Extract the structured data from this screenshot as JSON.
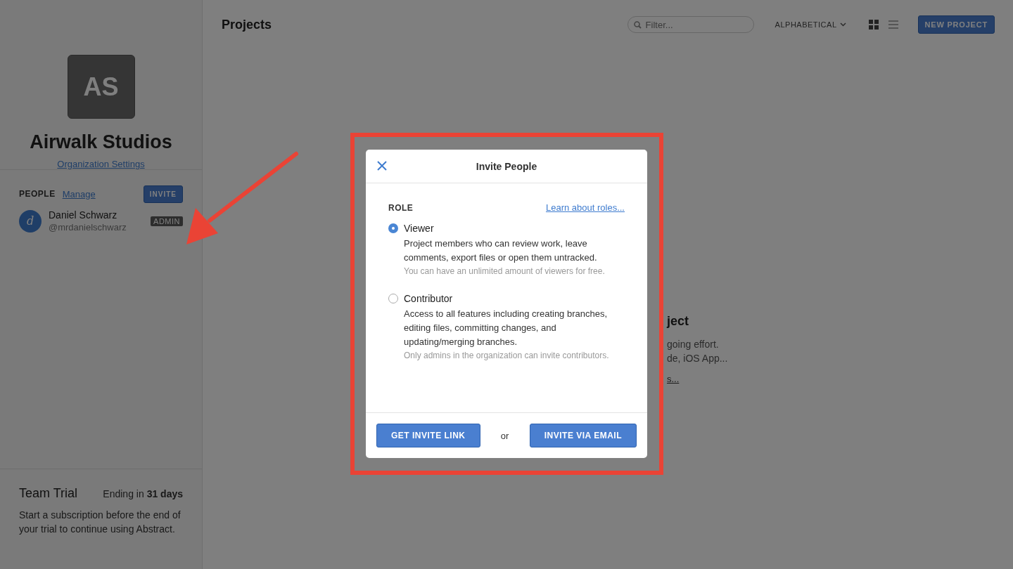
{
  "sidebar": {
    "org": {
      "initials": "AS",
      "name": "Airwalk Studios",
      "settings_link": "Organization Settings"
    },
    "people": {
      "heading": "PEOPLE",
      "manage_link": "Manage",
      "invite_button": "INVITE",
      "members": [
        {
          "avatar": "d",
          "name": "Daniel Schwarz",
          "handle": "@mrdanielschwarz",
          "role": "ADMIN"
        }
      ]
    },
    "trial": {
      "title": "Team Trial",
      "ending": "Ending in **31 days**",
      "body": "Start a subscription before the end of your trial to continue using Abstract."
    }
  },
  "header": {
    "title": "Projects",
    "filter": {
      "placeholder": "Filter..."
    },
    "sort": "ALPHABETICAL",
    "views": [
      {
        "kind": "grid",
        "selected": true
      },
      {
        "kind": "list",
        "selected": false
      }
    ],
    "new_project": "NEW PROJECT"
  },
  "empty_state": {
    "title": "ject",
    "lines": [
      "going effort.",
      "de, iOS App..."
    ],
    "link": "s..."
  },
  "dialog": {
    "title": "Invite People",
    "role_label": "ROLE",
    "learn_link": "Learn about roles...",
    "options": [
      {
        "label": "Viewer",
        "selected": true,
        "description": "Project members who can review work, leave comments, export files or open them untracked.",
        "note": "You can have an unlimited amount of viewers for free."
      },
      {
        "label": "Contributor",
        "selected": false,
        "description": "Access to all features including creating branches, editing files, committing changes, and updating/merging branches.",
        "note": "Only admins in the organization can invite contributors."
      }
    ],
    "or": "or",
    "buttons": [
      {
        "label": "GET INVITE LINK"
      },
      {
        "label": "INVITE VIA EMAIL"
      }
    ]
  }
}
